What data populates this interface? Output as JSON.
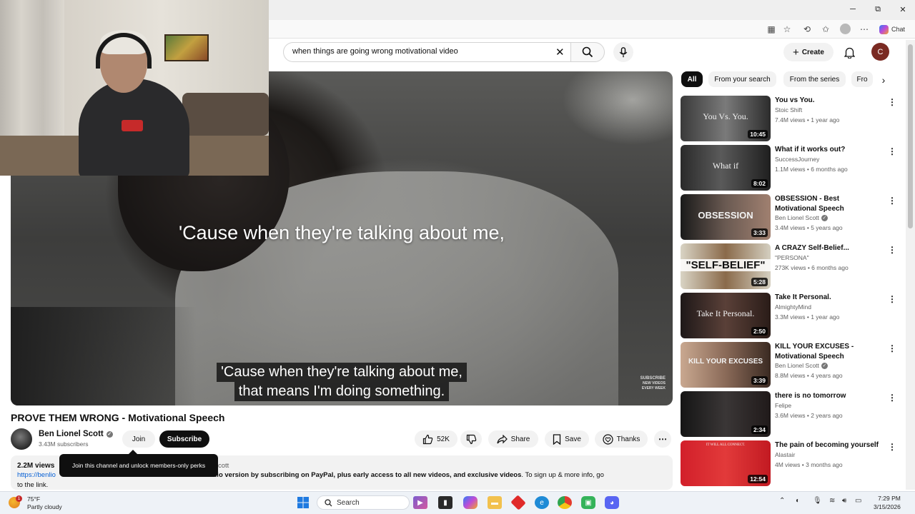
{
  "browser": {
    "minimize": "─",
    "maximize": "⧉",
    "close": "✕",
    "chat_label": "Chat"
  },
  "header": {
    "search_query": "when things are going wrong motivational video",
    "create_label": "Create",
    "user_initial": "C"
  },
  "video": {
    "caption_big": "'Cause when they're talking about me,",
    "subtitle_line1": "'Cause when they're talking about me,",
    "subtitle_line2": "that means I'm doing something.",
    "watermark_line1": "SUBSCRIBE",
    "watermark_line2": "NEW VIDEOS",
    "watermark_line3": "EVERY WEEK"
  },
  "details": {
    "title": "PROVE THEM WRONG - Motivational Speech",
    "channel_name": "Ben Lionel Scott",
    "subscribers": "3.43M subscribers",
    "join_label": "Join",
    "subscribe_label": "Subscribe",
    "like_count": "52K",
    "share_label": "Share",
    "save_label": "Save",
    "thanks_label": "Thanks",
    "tooltip": "Join this channel and unlock members-only perks"
  },
  "description": {
    "views": "2.2M views",
    "channel_fragment": "cott",
    "link_fragment": "https://benlio",
    "line2_text": "eo and audio version by subscribing on PayPal, plus early access to all new videos, and exclusive videos",
    "line2_suffix": ". To sign up & more info, go",
    "line3": "to the link."
  },
  "chips": [
    "All",
    "From your search",
    "From the series",
    "Fro"
  ],
  "recommendations": [
    {
      "title": "You vs You.",
      "channel": "Stoic Shift",
      "meta": "7.4M views • 1 year ago",
      "duration": "10:45",
      "thumb_text": "You Vs. You.",
      "verified": false
    },
    {
      "title": "What if it works out?",
      "channel": "SuccessJourney",
      "meta": "1.1M views • 6 months ago",
      "duration": "8:02",
      "thumb_text": "What if",
      "verified": false
    },
    {
      "title": "OBSESSION - Best Motivational Speech",
      "channel": "Ben Lionel Scott",
      "meta": "3.4M views • 5 years ago",
      "duration": "3:33",
      "thumb_text": "OBSESSION",
      "verified": true
    },
    {
      "title": "A CRAZY Self-Belief...",
      "channel": "\"PERSONA\"",
      "meta": "273K views • 6 months ago",
      "duration": "5:28",
      "thumb_text": "\"SELF-BELIEF\"",
      "verified": false
    },
    {
      "title": "Take It Personal.",
      "channel": "AlmightyMind",
      "meta": "3.3M views • 1 year ago",
      "duration": "2:50",
      "thumb_text": "Take It Personal.",
      "verified": false
    },
    {
      "title": "KILL YOUR EXCUSES - Motivational Speech",
      "channel": "Ben Lionel Scott",
      "meta": "8.8M views • 4 years ago",
      "duration": "3:39",
      "thumb_text": "KILL YOUR EXCUSES",
      "verified": true
    },
    {
      "title": "there is no tomorrow",
      "channel": "Felipe",
      "meta": "3.6M views • 2 years ago",
      "duration": "2:34",
      "thumb_text": "",
      "verified": false
    },
    {
      "title": "The pain of becoming yourself",
      "channel": "Alastair",
      "meta": "4M views • 3 months ago",
      "duration": "12:54",
      "thumb_text": "IT WILL ALL CONNECT.",
      "verified": false
    }
  ],
  "taskbar": {
    "temperature": "75°F",
    "condition": "Partly cloudy",
    "weather_badge": "1",
    "search_label": "Search",
    "time": "7:29 PM",
    "date": "3/15/2026"
  },
  "colors": {
    "accent_link": "#065fd4",
    "subscribe_bg": "#0f0f0f",
    "chip_bg": "#f2f2f2"
  }
}
